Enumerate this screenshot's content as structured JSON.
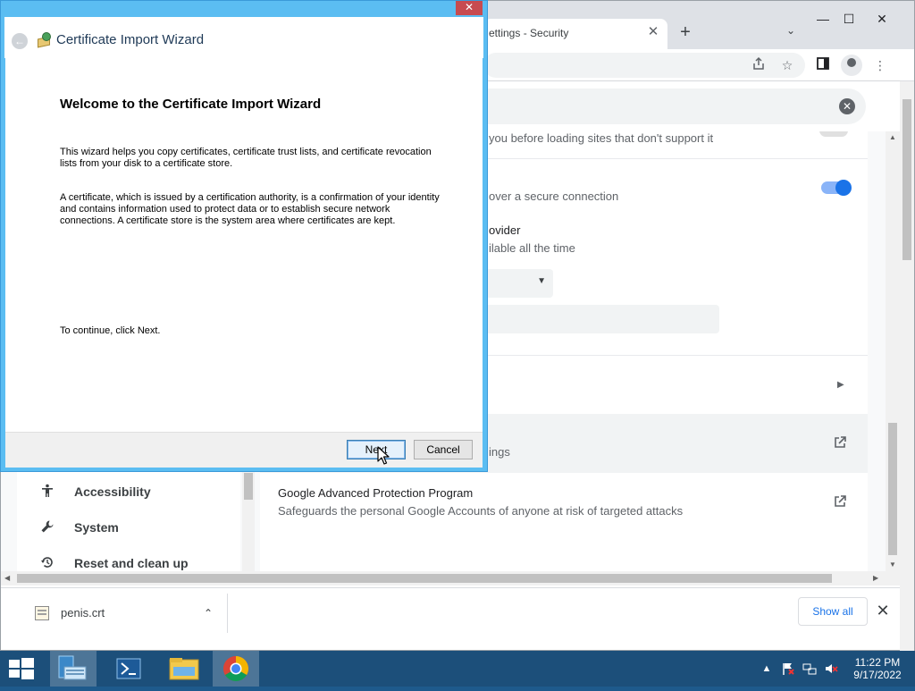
{
  "chrome": {
    "tab_title": "ettings - Security",
    "tab_close": "✕",
    "new_tab": "+",
    "tab_search": "⌄",
    "window_controls": {
      "minimize": "—",
      "maximize": "☐",
      "close": "✕"
    },
    "toolbar_icons": [
      "share-icon",
      "star-icon",
      "sidepanel-icon",
      "profile-icon",
      "menu-icon"
    ],
    "settings_search_clear": "✕",
    "sidebar": [
      {
        "icon": "accessibility-icon",
        "label": "Accessibility"
      },
      {
        "icon": "wrench-icon",
        "label": "System"
      },
      {
        "icon": "history-icon",
        "label": "Reset and clean up"
      }
    ],
    "security": {
      "row1_text": "you before loading sites that don't support it",
      "row2_text": "over a secure connection",
      "row3_title": "ovider",
      "row3_text": "ilable all the time",
      "row5_text": "ings",
      "advanced_title": "Google Advanced Protection Program",
      "advanced_desc": "Safeguards the personal Google Accounts of anyone at risk of targeted attacks"
    },
    "download": {
      "file_name": "penis.crt",
      "show_all": "Show all",
      "caret": "⌃",
      "close": "✕"
    }
  },
  "wizard": {
    "title": "Certificate Import Wizard",
    "close": "✕",
    "heading": "Welcome to the Certificate Import Wizard",
    "para1": [
      "This wizard helps you copy certificates, certificate trust lists, and certificate revocation",
      "lists from your disk to a certificate store."
    ],
    "para2": [
      "A certificate, which is issued by a certification authority, is a confirmation of your identity",
      "and contains information used to protect data or to establish secure network",
      "connections. A certificate store is the system area where certificates are kept."
    ],
    "continue_text": "To continue, click Next.",
    "next_label": "Next",
    "cancel_label": "Cancel"
  },
  "taskbar": {
    "time": "11:22 PM",
    "date": "9/17/2022",
    "apps": [
      "server-manager-icon",
      "powershell-icon",
      "file-explorer-icon",
      "chrome-icon"
    ]
  }
}
